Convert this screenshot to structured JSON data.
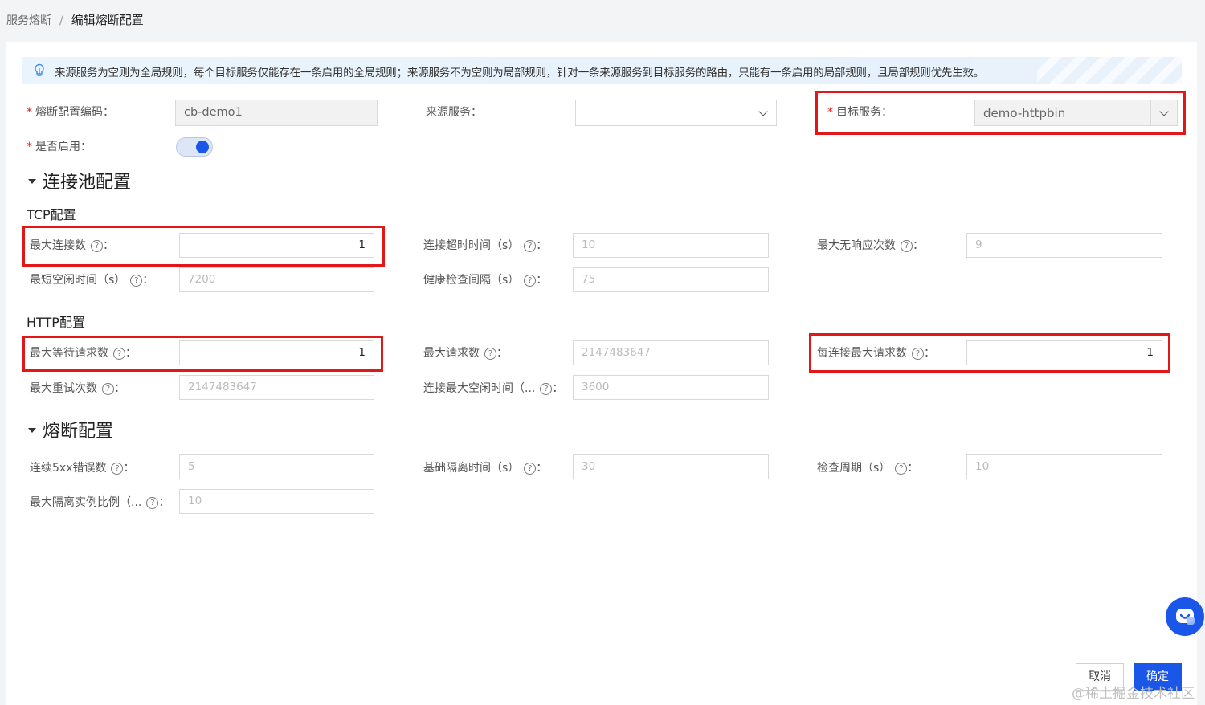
{
  "breadcrumb": {
    "parent": "服务熔断",
    "separator": "/",
    "current": "编辑熔断配置"
  },
  "alert": {
    "icon": "lightbulb-icon",
    "text": "来源服务为空则为全局规则，每个目标服务仅能存在一条启用的全局规则；来源服务不为空则为局部规则，针对一条来源服务到目标服务的路由，只能有一条启用的局部规则，且局部规则优先生效。"
  },
  "basic": {
    "code_label": "熔断配置编码：",
    "code_value": "cb-demo1",
    "source_label": "来源服务：",
    "source_value": "",
    "target_label": "目标服务：",
    "target_value": "demo-httpbin",
    "enabled_label": "是否启用：",
    "enabled": true
  },
  "pool": {
    "title": "连接池配置",
    "tcp_title": "TCP配置",
    "tcp": {
      "max_conn_label": "最大连接数",
      "max_conn_value": "1",
      "conn_timeout_label": "连接超时时间（s）",
      "conn_timeout_placeholder": "10",
      "max_noresp_label": "最大无响应次数",
      "max_noresp_placeholder": "9",
      "min_idle_label": "最短空闲时间（s）",
      "min_idle_placeholder": "7200",
      "health_label": "健康检查间隔（s）",
      "health_placeholder": "75"
    },
    "http_title": "HTTP配置",
    "http": {
      "max_pending_label": "最大等待请求数",
      "max_pending_value": "1",
      "max_req_label": "最大请求数",
      "max_req_placeholder": "2147483647",
      "per_conn_label": "每连接最大请求数",
      "per_conn_value": "1",
      "max_retry_label": "最大重试次数",
      "max_retry_placeholder": "2147483647",
      "conn_idle_label": "连接最大空闲时间（...",
      "conn_idle_placeholder": "3600"
    }
  },
  "breaker": {
    "title": "熔断配置",
    "consec_label": "连续5xx错误数",
    "consec_placeholder": "5",
    "base_eject_label": "基础隔离时间（s）",
    "base_eject_placeholder": "30",
    "interval_label": "检查周期（s）",
    "interval_placeholder": "10",
    "max_eject_label": "最大隔离实例比例（...",
    "max_eject_placeholder": "10"
  },
  "hint_glyph": "?",
  "colon": "：",
  "footer": {
    "cancel": "取消",
    "ok": "确定"
  },
  "watermark": "@稀土掘金技术社区",
  "colors": {
    "primary": "#1a56e8",
    "highlight": "#e01818",
    "required": "#e02020"
  }
}
